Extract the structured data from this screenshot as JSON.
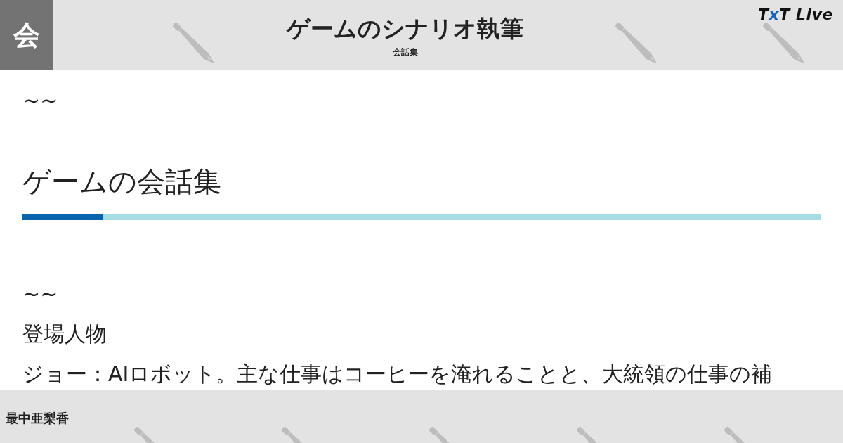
{
  "header": {
    "avatar": "会",
    "title": "ゲームのシナリオ執筆",
    "subtitle": "会話集",
    "logo": [
      {
        "text": "T",
        "color": "#111111"
      },
      {
        "text": "x",
        "color": "#1565c0"
      },
      {
        "text": "T Live",
        "color": "#111111"
      }
    ]
  },
  "article": [
    {
      "kind": "text",
      "text": "~~"
    },
    {
      "kind": "heading",
      "text": "ゲームの会話集",
      "level": 0.1
    },
    {
      "kind": "text",
      "text": "~~"
    },
    {
      "kind": "text",
      "text": "登場人物"
    },
    {
      "kind": "text",
      "text": "ジョー：AIロボット。主な仕事はコーヒーを淹れることと、大統領の仕事の補"
    }
  ],
  "footer": {
    "author": "最中亜梨香"
  }
}
